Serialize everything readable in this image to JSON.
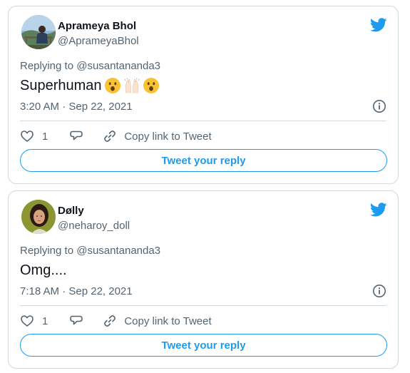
{
  "tweets": [
    {
      "display_name": "Aprameya Bhol",
      "handle": "@AprameyaBhol",
      "replying_to": "Replying to @susantananda3",
      "body_text": "Superhuman",
      "emojis": [
        "face-with-open-mouth",
        "raising-hands",
        "face-with-open-mouth"
      ],
      "timestamp": "3:20 AM · Sep 22, 2021",
      "like_count": "1",
      "copy_link_label": "Copy link to Tweet",
      "reply_button_label": "Tweet your reply"
    },
    {
      "display_name": "Dølly",
      "handle": "@neharoy_doll",
      "replying_to": "Replying to @susantananda3",
      "body_text": "Omg....",
      "emojis": [],
      "timestamp": "7:18 AM · Sep 22, 2021",
      "like_count": "1",
      "copy_link_label": "Copy link to Tweet",
      "reply_button_label": "Tweet your reply"
    }
  ],
  "colors": {
    "twitter_blue": "#1d9bf0",
    "secondary_text": "#536471",
    "primary_text": "#0f1419",
    "border": "#cfd9de"
  }
}
